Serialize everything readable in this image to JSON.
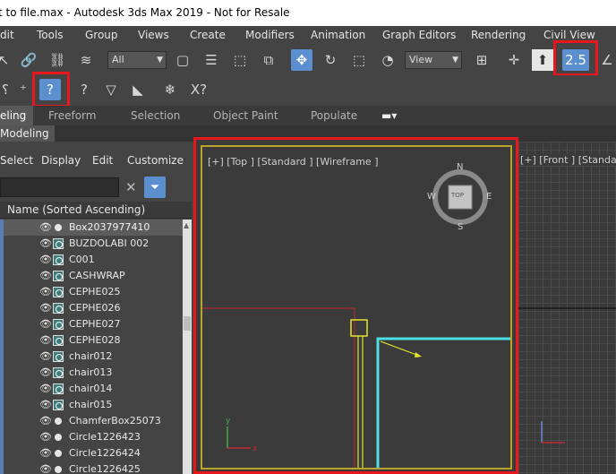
{
  "window": {
    "title": "t to file.max - Autodesk 3ds Max 2019 - Not for Resale"
  },
  "menu": [
    "dit",
    "Tools",
    "Group",
    "Views",
    "Create",
    "Modifiers",
    "Animation",
    "Graph Editors",
    "Rendering",
    "Civil View"
  ],
  "toolbar": {
    "selection_filter": "All",
    "reference_coord": "View"
  },
  "ribbon": {
    "tabs": [
      "eling",
      "Freeform",
      "Selection",
      "Object Paint",
      "Populate"
    ],
    "sub_tab": "Modeling"
  },
  "explorer": {
    "menu": [
      "Select",
      "Display",
      "Edit",
      "Customize"
    ],
    "search_value": "",
    "column_header": "Name (Sorted Ascending)",
    "rows": [
      {
        "name": "Box2037977410",
        "type": "dot",
        "selected": true
      },
      {
        "name": "BUZDOLABI 002",
        "type": "object"
      },
      {
        "name": "C001",
        "type": "object"
      },
      {
        "name": "CASHWRAP",
        "type": "object"
      },
      {
        "name": "CEPHE025",
        "type": "object"
      },
      {
        "name": "CEPHE026",
        "type": "object"
      },
      {
        "name": "CEPHE027",
        "type": "object"
      },
      {
        "name": "CEPHE028",
        "type": "object"
      },
      {
        "name": "chair012",
        "type": "object"
      },
      {
        "name": "chair013",
        "type": "object"
      },
      {
        "name": "chair014",
        "type": "object"
      },
      {
        "name": "chair015",
        "type": "object"
      },
      {
        "name": "ChamferBox25073",
        "type": "dot"
      },
      {
        "name": "Circle1226423",
        "type": "dot"
      },
      {
        "name": "Circle1226424",
        "type": "dot"
      },
      {
        "name": "Circle1226425",
        "type": "dot"
      }
    ]
  },
  "viewports": {
    "top_label": "[+] [Top ] [Standard ] [Wireframe ]",
    "front_label": "[+] [Front ] [Standard",
    "viewcube": {
      "face": "TOP",
      "n": "N",
      "s": "S",
      "e": "E",
      "w": "W"
    }
  },
  "colors": {
    "highlight": "#e8161d",
    "accent": "#5b8fcf",
    "active_border": "#b8a52a",
    "cyan_object": "#4de0e6"
  }
}
